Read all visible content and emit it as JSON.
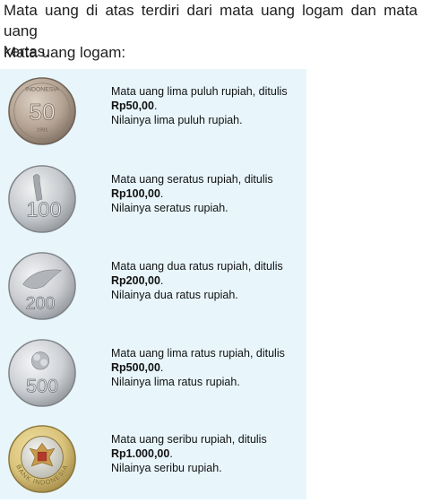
{
  "intro_line1": "Mata uang di atas terdiri dari mata uang logam dan mata uang",
  "intro_line2": "kertas.",
  "subheading": "Mata uang logam:",
  "coins": [
    {
      "icon": "coin-50-icon",
      "face_value": "50",
      "line1": "Mata uang lima puluh rupiah, ditulis",
      "amount": "Rp50,00",
      "line3": "Nilainya lima puluh rupiah."
    },
    {
      "icon": "coin-100-icon",
      "face_value": "100",
      "line1": "Mata uang seratus rupiah, ditulis",
      "amount": "Rp100,00",
      "line3": "Nilainya seratus rupiah."
    },
    {
      "icon": "coin-200-icon",
      "face_value": "200",
      "line1": "Mata uang dua ratus rupiah, ditulis",
      "amount": "Rp200,00",
      "line3": "Nilainya dua ratus rupiah."
    },
    {
      "icon": "coin-500-icon",
      "face_value": "500",
      "line1": "Mata uang lima ratus rupiah, ditulis",
      "amount": "Rp500,00",
      "line3": "Nilainya lima ratus rupiah."
    },
    {
      "icon": "coin-1000-icon",
      "face_value": "BANK INDONESIA",
      "line1": "Mata uang seribu rupiah, ditulis",
      "amount": "Rp1.000,00",
      "line3": "Nilainya seribu rupiah."
    }
  ],
  "colors": {
    "panel_bg": "#e8f6fc",
    "coin_50": "#b8a89a",
    "coin_silver": "#c8cbcf",
    "coin_1000_ring": "#d9c27a"
  }
}
